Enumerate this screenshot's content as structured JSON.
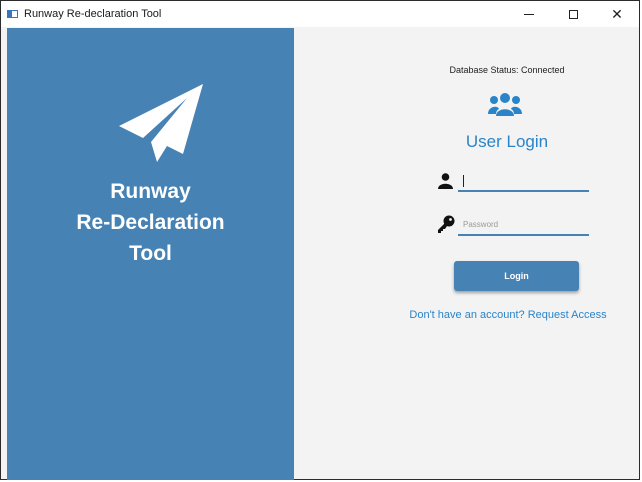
{
  "window": {
    "title": "Runway Re-declaration Tool",
    "controls": [
      "minimize",
      "maximize",
      "close"
    ]
  },
  "brand": {
    "line1": "Runway",
    "line2": "Re-Declaration",
    "line3": "Tool",
    "icon": "paper-plane-icon",
    "panel_color": "#4682b4"
  },
  "login": {
    "db_status": "Database Status: Connected",
    "icon": "users-icon",
    "title": "User Login",
    "username_icon": "user-icon",
    "username_value": "",
    "password_icon": "key-icon",
    "password_placeholder": "Password",
    "button_label": "Login",
    "request_access_label": "Don't have an account? Request Access",
    "accent_color": "#2a84c9"
  }
}
